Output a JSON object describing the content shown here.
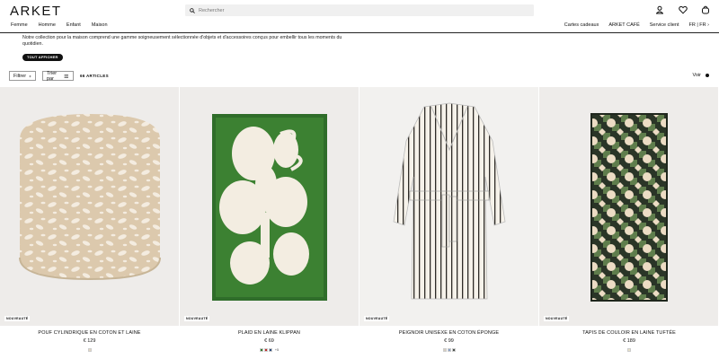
{
  "brand": "ARKET",
  "search_placeholder": "Rechercher",
  "main_nav": [
    "Femme",
    "Homme",
    "Enfant",
    "Maison"
  ],
  "secondary_nav": [
    "Cartes cadeaux",
    "ARKET CAFÉ",
    "Service client",
    "FR | FR ›"
  ],
  "intro": {
    "text": "Notre collection pour la maison comprend une gamme soigneusement sélectionnée d'objets et d'accessoires conçus pour embellir tous les moments du quotidien.",
    "button": "TOUT AFFICHER"
  },
  "toolbar": {
    "filter": "Filtrer",
    "sort": "Trier par",
    "count": "66 ARTICLES",
    "view": "Voir"
  },
  "products": [
    {
      "badge": "NOUVEAUTÉ",
      "name": "POUF CYLINDRIQUE EN COTON ET LAINE",
      "price": "€ 129",
      "swatches": [
        "#e6d8c2"
      ],
      "more": ""
    },
    {
      "badge": "NOUVEAUTÉ",
      "name": "PLAID EN LAINE KLIPPAN",
      "price": "€ 69",
      "swatches": [
        "#2f7a2a",
        "#c22a2a",
        "#2a4a7a"
      ],
      "more": "+5"
    },
    {
      "badge": "NOUVEAUTÉ",
      "name": "PEIGNOIR UNISEXE EN COTON ÉPONGE",
      "price": "€ 99",
      "swatches": [
        "#d8cdbd",
        "#8aa2c8",
        "#4a4f4a"
      ],
      "more": ""
    },
    {
      "badge": "NOUVEAUTÉ",
      "name": "TAPIS DE COULOIR EN LAINE TUFTÉE",
      "price": "€ 189",
      "swatches": [
        "#e9e2c8"
      ],
      "more": ""
    }
  ],
  "icons": [
    "search-icon",
    "account-icon",
    "wishlist-icon",
    "bag-icon",
    "plus-icon",
    "sort-lines-icon"
  ]
}
